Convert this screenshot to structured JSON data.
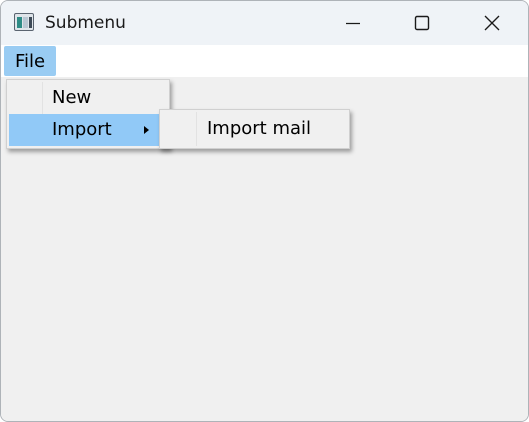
{
  "window": {
    "title": "Submenu",
    "icon": "app-window-icon",
    "controls": {
      "minimize_icon": "minimize-icon",
      "maximize_icon": "maximize-icon",
      "close_icon": "close-icon"
    }
  },
  "menubar": {
    "items": [
      {
        "label": "File",
        "open": true
      }
    ]
  },
  "menu": {
    "items": [
      {
        "label": "New",
        "has_submenu": false,
        "highlighted": false
      },
      {
        "label": "Import",
        "has_submenu": true,
        "highlighted": true
      }
    ]
  },
  "submenu": {
    "items": [
      {
        "label": "Import mail"
      }
    ]
  },
  "colors": {
    "titlebar": "#eff3f7",
    "menubar_active": "#99ccf3",
    "menu_highlight": "#91c9f7",
    "client_background": "#f0f0f0"
  }
}
